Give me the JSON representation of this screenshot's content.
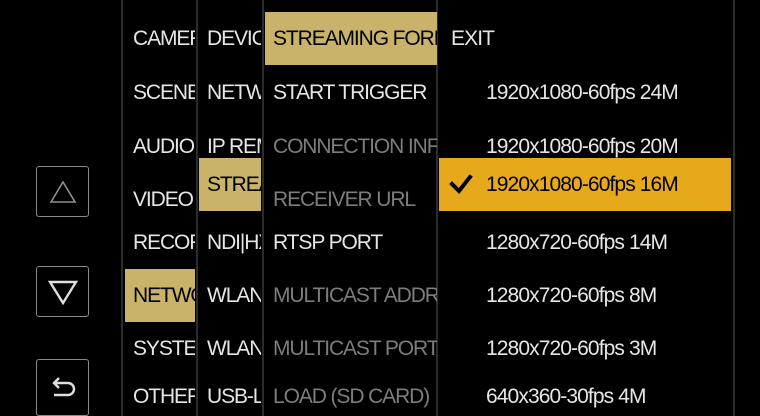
{
  "colors": {
    "selected_bg": "#c9b36b",
    "highlight_bg": "#e6a91c",
    "text": "#e6e6e6",
    "dim_text": "#7d7d7d"
  },
  "nav": {
    "up_icon": "triangle-up-icon",
    "down_icon": "triangle-down-icon",
    "back_icon": "return-arrow-icon"
  },
  "menu": {
    "col1": [
      "CAMERA",
      "SCENE",
      "AUDIO",
      "VIDEO OUT",
      "RECORDING",
      "NETWORK",
      "SYSTEM",
      "OTHERS"
    ],
    "col2": [
      "DEVICE",
      "NETWORK",
      "IP REMOTE",
      "STREAMING",
      "NDI|HX",
      "WLAN",
      "WLAN",
      "USB-LAN"
    ],
    "col3": [
      "STREAMING FORMAT",
      "START TRIGGER",
      "CONNECTION INFO",
      "RECEIVER URL",
      "RTSP PORT",
      "MULTICAST ADDRESS",
      "MULTICAST PORT",
      "LOAD (SD CARD)"
    ],
    "col4": {
      "exit": "EXIT",
      "options": [
        "1920x1080-60fps 24M",
        "1920x1080-60fps 20M",
        "1920x1080-60fps 16M",
        "1280x720-60fps 14M",
        "1280x720-60fps 8M",
        "1280x720-60fps 3M",
        "640x360-30fps 4M"
      ],
      "selected_icon": "checkmark-icon"
    }
  }
}
